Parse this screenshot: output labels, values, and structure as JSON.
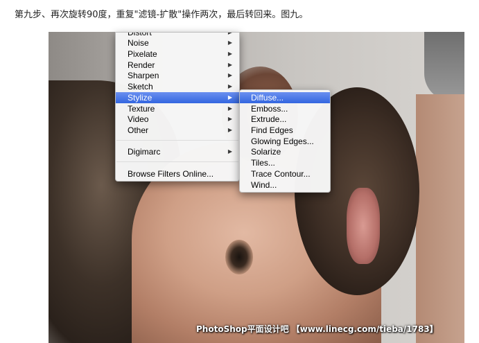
{
  "instruction_text": "第九步、再次旋转90度，重复\"滤镜-扩散\"操作两次，最后转回来。图九。",
  "watermark_text": "PhotoShop平面设计吧 【www.linecg.com/tieba/1783】",
  "main_menu": {
    "items": [
      {
        "label": "Distort",
        "has_submenu": true,
        "highlighted": false
      },
      {
        "label": "Noise",
        "has_submenu": true,
        "highlighted": false
      },
      {
        "label": "Pixelate",
        "has_submenu": true,
        "highlighted": false
      },
      {
        "label": "Render",
        "has_submenu": true,
        "highlighted": false
      },
      {
        "label": "Sharpen",
        "has_submenu": true,
        "highlighted": false
      },
      {
        "label": "Sketch",
        "has_submenu": true,
        "highlighted": false
      },
      {
        "label": "Stylize",
        "has_submenu": true,
        "highlighted": true
      },
      {
        "label": "Texture",
        "has_submenu": true,
        "highlighted": false
      },
      {
        "label": "Video",
        "has_submenu": true,
        "highlighted": false
      },
      {
        "label": "Other",
        "has_submenu": true,
        "highlighted": false
      },
      {
        "label": "Digimarc",
        "has_submenu": true,
        "highlighted": false
      },
      {
        "label": "Browse Filters Online...",
        "has_submenu": false,
        "highlighted": false
      }
    ]
  },
  "stylize_submenu": {
    "items": [
      {
        "label": "Diffuse...",
        "highlighted": true
      },
      {
        "label": "Emboss...",
        "highlighted": false
      },
      {
        "label": "Extrude...",
        "highlighted": false
      },
      {
        "label": "Find Edges",
        "highlighted": false
      },
      {
        "label": "Glowing Edges...",
        "highlighted": false
      },
      {
        "label": "Solarize",
        "highlighted": false
      },
      {
        "label": "Tiles...",
        "highlighted": false
      },
      {
        "label": "Trace Contour...",
        "highlighted": false
      },
      {
        "label": "Wind...",
        "highlighted": false
      }
    ]
  },
  "icons": {
    "submenu_arrow": "triangle-right-icon"
  },
  "colors": {
    "highlight": "#3366e0",
    "menu_bg": "#f6f6f6"
  }
}
